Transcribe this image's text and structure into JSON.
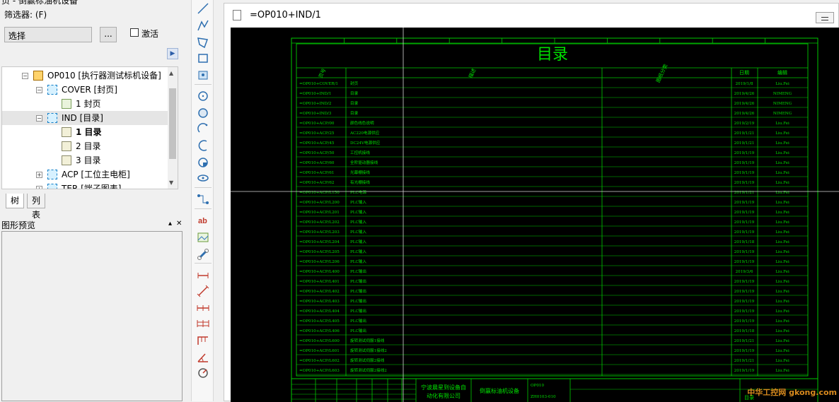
{
  "left_panel": {
    "cut_title": "页 - 倒赢标油机设备",
    "filter_label": "筛选器: (F)",
    "select_value": "选择",
    "more_button": "...",
    "activate_label": "激活",
    "tree": [
      {
        "label": "OP010 [执行器测试标机设备]",
        "level": 0,
        "kind": "project",
        "expander": "−"
      },
      {
        "label": "COVER [封页]",
        "level": 1,
        "kind": "function",
        "expander": "−"
      },
      {
        "label": "1 封页",
        "level": 2,
        "kind": "page-cover",
        "expander": ""
      },
      {
        "label": "IND [目录]",
        "level": 1,
        "kind": "function",
        "expander": "−"
      },
      {
        "label": "1 目录",
        "level": 2,
        "kind": "page",
        "expander": "",
        "bold": true
      },
      {
        "label": "2 目录",
        "level": 2,
        "kind": "page",
        "expander": ""
      },
      {
        "label": "3 目录",
        "level": 2,
        "kind": "page",
        "expander": ""
      },
      {
        "label": "ACP [工位主电柜]",
        "level": 1,
        "kind": "function",
        "expander": "+"
      },
      {
        "label": "TER [端子图表]",
        "level": 1,
        "kind": "function",
        "expander": "+"
      }
    ],
    "tabs": [
      "树",
      "列表"
    ],
    "preview_title": "图形预览"
  },
  "toolbar": {
    "tools": [
      "line-tool-icon",
      "polyline-tool-icon",
      "polygon-tool-icon",
      "rectangle-tool-icon",
      "insert-symbol-icon",
      "circle-center-icon",
      "circle-icon",
      "arc-icon",
      "arc-3pt-icon",
      "pie-icon",
      "ellipse-icon",
      "connection-icon",
      "text-tool-icon",
      "image-tool-icon",
      "hyperlink-tool-icon",
      "dimension-linear-icon",
      "dimension-aligned-icon",
      "dimension-chain-icon",
      "dimension-base-icon",
      "dimension-increment-icon",
      "dimension-angle-icon",
      "dimension-radius-icon"
    ]
  },
  "document": {
    "title": "=OP010+IND/1",
    "sheet": {
      "heading": "目录",
      "col_headers": [
        "页号",
        "描述",
        "图纸分类",
        "日期",
        "编辑"
      ],
      "rows": [
        [
          "=OP010+COVER/1",
          "封页",
          "2019/1/8",
          "Liu.Fei"
        ],
        [
          "=OP010+IND/1",
          "目录",
          "2019/4/26",
          "NIMENG"
        ],
        [
          "=OP010+IND/2",
          "目录",
          "2019/4/26",
          "NIMENG"
        ],
        [
          "=OP010+IND/3",
          "目录",
          "2019/4/26",
          "NIMENG"
        ],
        [
          "=OP010+ACP/00",
          "颜色线色说明",
          "2019/2/19",
          "Liu.Fei"
        ],
        [
          "=OP010+ACP/25",
          "AC220电源供应",
          "2019/1/21",
          "Liu.Fei"
        ],
        [
          "=OP010+ACP/45",
          "DC24V电源供应",
          "2019/1/21",
          "Liu.Fei"
        ],
        [
          "=OP010+ACP/50",
          "工控机接线",
          "2019/1/19",
          "Liu.Fei"
        ],
        [
          "=OP010+ACP/60",
          "全阶驱动器接线",
          "2019/1/19",
          "Liu.Fei"
        ],
        [
          "=OP010+ACP/61",
          "光幕栅接线",
          "2019/1/19",
          "Liu.Fei"
        ],
        [
          "=OP010+ACP/62",
          "有光栅接线",
          "2019/1/19",
          "Liu.Fei"
        ],
        [
          "=OP010+ACP/L150",
          "PLC电源",
          "2019/1/21",
          "Liu.Fei"
        ],
        [
          "=OP010+ACP/L200",
          "PLC输入",
          "2019/1/19",
          "Liu.Fei"
        ],
        [
          "=OP010+ACP/L201",
          "PLC输入",
          "2019/1/19",
          "Liu.Fei"
        ],
        [
          "=OP010+ACP/L202",
          "PLC输入",
          "2019/1/19",
          "Liu.Fei"
        ],
        [
          "=OP010+ACP/L203",
          "PLC输入",
          "2019/1/19",
          "Liu.Fei"
        ],
        [
          "=OP010+ACP/L204",
          "PLC输入",
          "2019/1/18",
          "Liu.Fei"
        ],
        [
          "=OP010+ACP/L205",
          "PLC输入",
          "2019/1/19",
          "Liu.Fei"
        ],
        [
          "=OP010+ACP/L206",
          "PLC输入",
          "2019/1/19",
          "Liu.Fei"
        ],
        [
          "=OP010+ACP/L400",
          "PLC输出",
          "2019/3/6",
          "Liu.Fei"
        ],
        [
          "=OP010+ACP/L401",
          "PLC输出",
          "2019/1/19",
          "Liu.Fei"
        ],
        [
          "=OP010+ACP/L402",
          "PLC输出",
          "2019/1/19",
          "Liu.Fei"
        ],
        [
          "=OP010+ACP/L403",
          "PLC输出",
          "2019/1/19",
          "Liu.Fei"
        ],
        [
          "=OP010+ACP/L404",
          "PLC输出",
          "2019/1/19",
          "Liu.Fei"
        ],
        [
          "=OP010+ACP/L405",
          "PLC输出",
          "2019/1/19",
          "Liu.Fei"
        ],
        [
          "=OP010+ACP/L406",
          "PLC输出",
          "2019/1/18",
          "Liu.Fei"
        ],
        [
          "=OP010+ACP/L600",
          "旋转测试伺服1接线",
          "2019/1/21",
          "Liu.Fei"
        ],
        [
          "=OP010+ACP/L601",
          "旋转测试伺服1接线2",
          "2019/1/19",
          "Liu.Fei"
        ],
        [
          "=OP010+ACP/L602",
          "旋转测试伺服2接线",
          "2019/1/21",
          "Liu.Fei"
        ],
        [
          "=OP010+ACP/L603",
          "旋转测试伺服2接线2",
          "2019/1/19",
          "Liu.Fei"
        ]
      ],
      "company": [
        "宁波晨星到设备自",
        "动化有限公司"
      ],
      "project_name": "倒赢标油机设备",
      "tb_code1": "OP010",
      "tb_code2": "ZH0103-010",
      "tb_label": "目录"
    },
    "watermark": "中华工控网 gkong.com",
    "colors": {
      "line": "#00c800",
      "text": "#00e000",
      "bg": "#000000"
    }
  }
}
